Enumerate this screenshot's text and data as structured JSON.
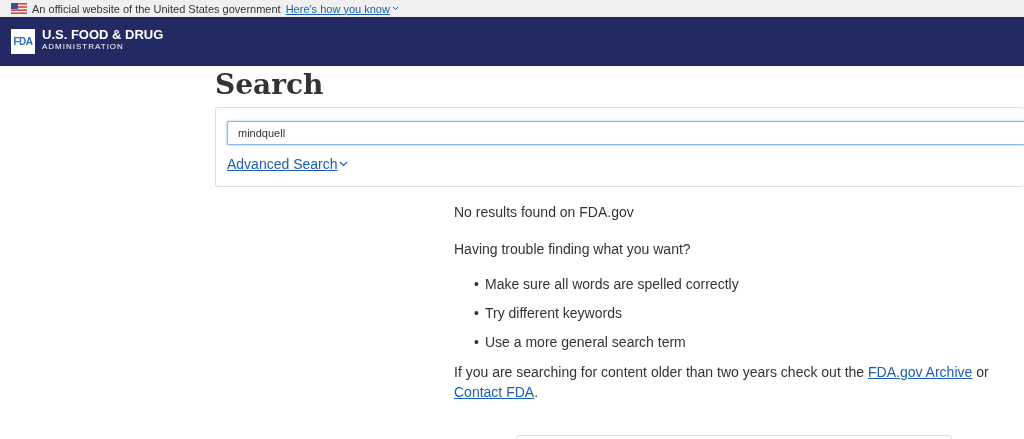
{
  "gov_banner": {
    "text": "An official website of the United States government",
    "link": "Here's how you know"
  },
  "header": {
    "logo_mark": "FDA",
    "title": "U.S. FOOD & DRUG",
    "subtitle": "ADMINISTRATION"
  },
  "page_title": "Search",
  "search": {
    "value": "mindquell",
    "advanced_link": "Advanced Search"
  },
  "results": {
    "message": "No results found on FDA.gov",
    "help_heading": "Having trouble finding what you want?",
    "tip_marker": "•",
    "tips": [
      "Make sure all words are spelled correctly",
      "Try different keywords",
      "Use a more general search term"
    ],
    "archive_note": {
      "before": "If you are searching for content older than two years check out the",
      "archive_link": "FDA.gov Archive",
      "middle": "or",
      "contact_link": "Contact FDA",
      "after": "."
    }
  }
}
